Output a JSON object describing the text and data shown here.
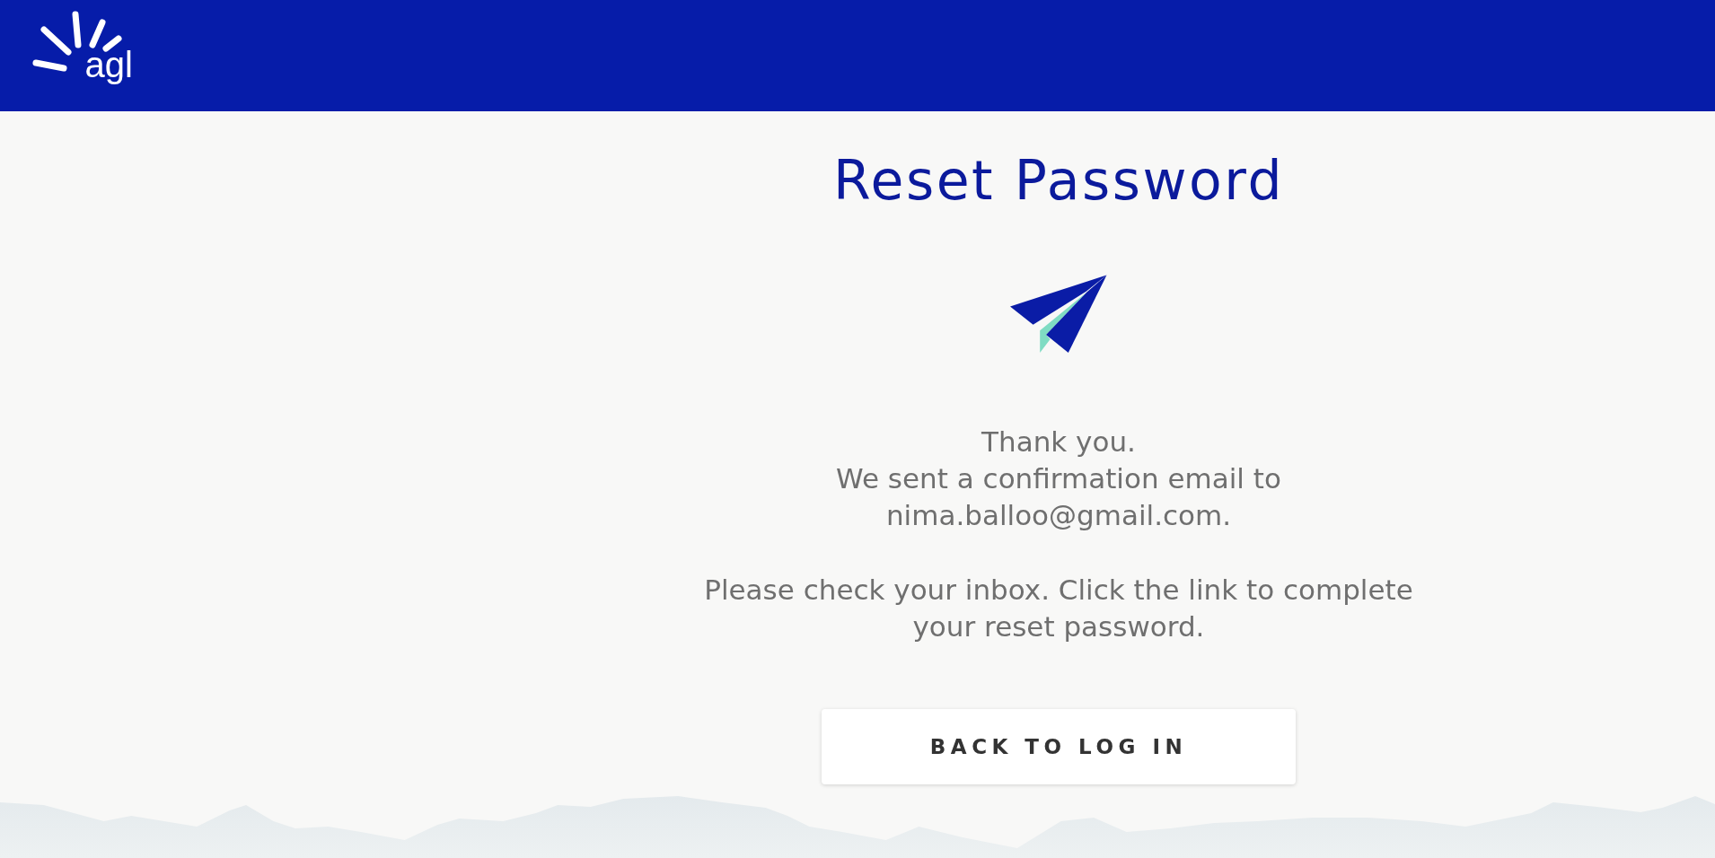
{
  "header": {
    "logo": {
      "text": "agl"
    }
  },
  "title": "Reset Password",
  "message": {
    "greeting": "Thank you.",
    "confirmation": "We sent a confirmation email to nima.balloo@gmail.com.",
    "instruction": "Please check your inbox. Click the link to complete your reset password."
  },
  "button": {
    "label": "BACK TO LOG IN"
  }
}
